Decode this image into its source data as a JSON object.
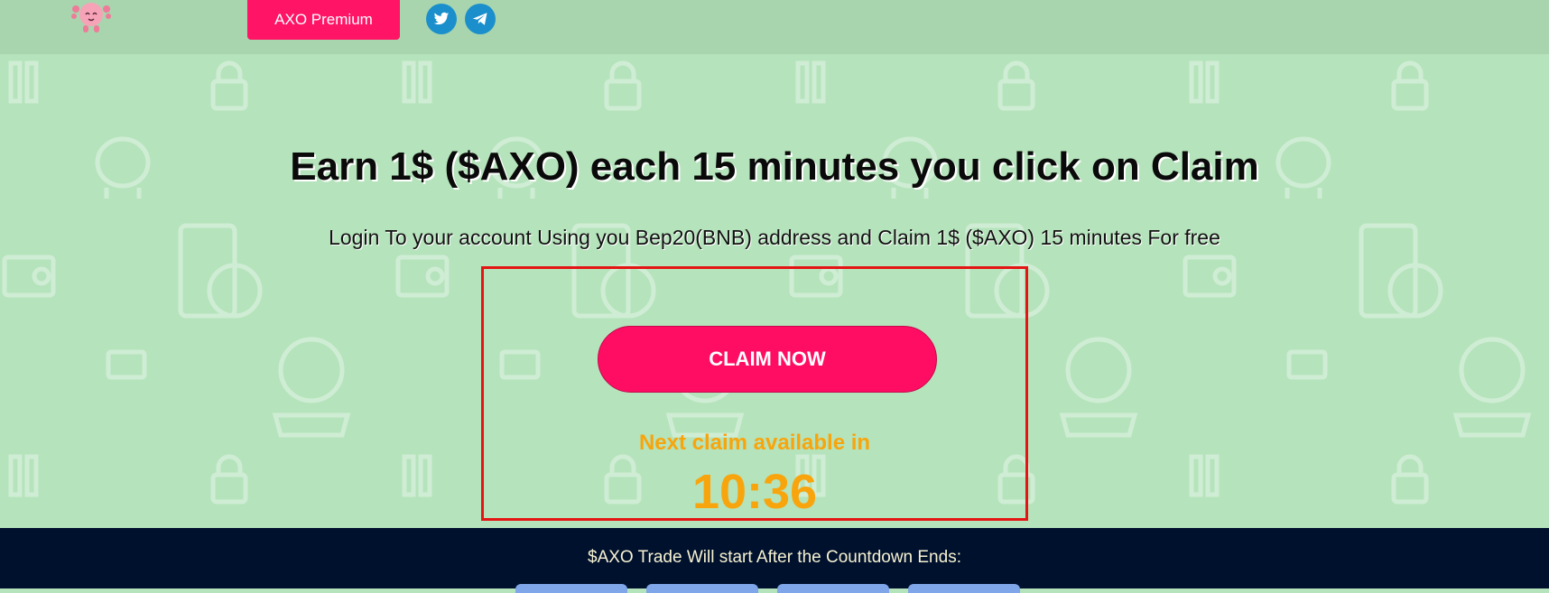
{
  "header": {
    "logo_icon": "axolotl-logo-icon",
    "premium_label": "AXO Premium",
    "social": [
      "twitter-icon",
      "telegram-icon"
    ]
  },
  "hero": {
    "headline": "Earn 1$ ($AXO) each 15 minutes you click on Claim",
    "subline": "Login To your account Using you Bep20(BNB) address and Claim 1$ ($AXO) 15 minutes For free"
  },
  "claim": {
    "button_label": "CLAIM NOW",
    "next_label": "Next claim available in",
    "timer": "10:36"
  },
  "footer": {
    "countdown_text": "$AXO Trade Will start After the Countdown Ends:"
  },
  "colors": {
    "accent": "#ff0d63",
    "timer": "#f8a50d",
    "background": "#b5e3bb",
    "footer": "#00112d",
    "highlight": "#e41414"
  }
}
